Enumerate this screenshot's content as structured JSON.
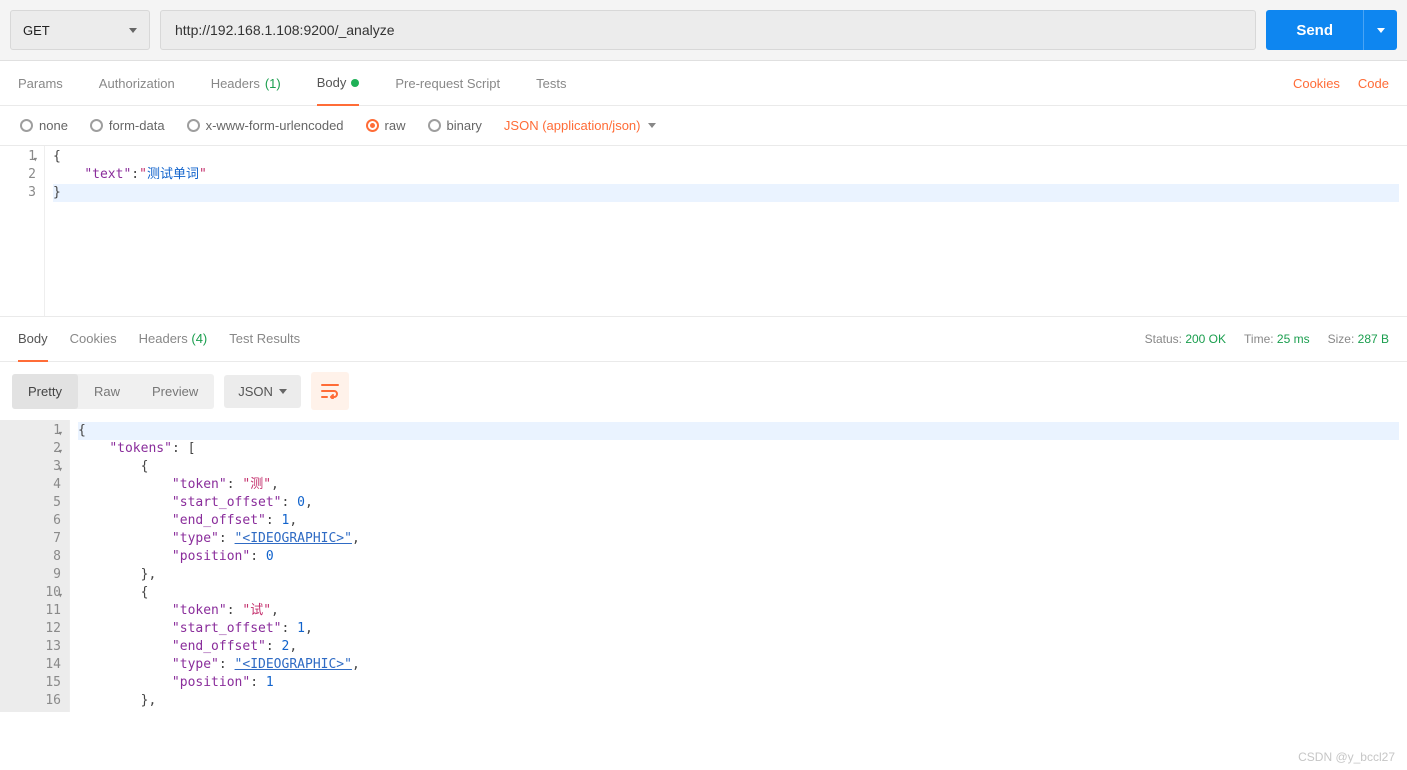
{
  "request": {
    "method": "GET",
    "url": "http://192.168.1.108:9200/_analyze",
    "send_label": "Send"
  },
  "req_tabs": {
    "params": "Params",
    "auth": "Authorization",
    "headers": "Headers",
    "headers_count": "(1)",
    "body": "Body",
    "prereq": "Pre-request Script",
    "tests": "Tests"
  },
  "header_links": {
    "cookies": "Cookies",
    "code": "Code"
  },
  "body_types": {
    "none": "none",
    "formdata": "form-data",
    "xform": "x-www-form-urlencoded",
    "raw": "raw",
    "binary": "binary",
    "content_type": "JSON (application/json)"
  },
  "req_body": {
    "lines": [
      "1",
      "2",
      "3"
    ],
    "l1": "{",
    "l2_key": "\"text\"",
    "l2_colon": ":",
    "l2_val1": "\"",
    "l2_val2": "测试单词",
    "l2_val3": "\"",
    "l3": "}"
  },
  "resp_tabs": {
    "body": "Body",
    "cookies": "Cookies",
    "headers": "Headers",
    "headers_count": "(4)",
    "tests": "Test Results"
  },
  "resp_meta": {
    "status_label": "Status:",
    "status_value": "200 OK",
    "time_label": "Time:",
    "time_value": "25 ms",
    "size_label": "Size:",
    "size_value": "287 B"
  },
  "resp_toolbar": {
    "pretty": "Pretty",
    "raw": "Raw",
    "preview": "Preview",
    "format": "JSON"
  },
  "resp_body": {
    "gutter": [
      "1",
      "2",
      "3",
      "4",
      "5",
      "6",
      "7",
      "8",
      "9",
      "10",
      "11",
      "12",
      "13",
      "14",
      "15",
      "16"
    ],
    "l1": "{",
    "l2_key": "\"tokens\"",
    "l2_rest": ": [",
    "l3": "        {",
    "l4_key": "\"token\"",
    "l4_val": "\"测\"",
    "l5_key": "\"start_offset\"",
    "l5_val": "0",
    "l6_key": "\"end_offset\"",
    "l6_val": "1",
    "l7_key": "\"type\"",
    "l7_val": "\"<IDEOGRAPHIC>\"",
    "l8_key": "\"position\"",
    "l8_val": "0",
    "l9": "        },",
    "l10": "        {",
    "l11_key": "\"token\"",
    "l11_val": "\"试\"",
    "l12_key": "\"start_offset\"",
    "l12_val": "1",
    "l13_key": "\"end_offset\"",
    "l13_val": "2",
    "l14_key": "\"type\"",
    "l14_val": "\"<IDEOGRAPHIC>\"",
    "l15_key": "\"position\"",
    "l15_val": "1",
    "l16": "        },"
  },
  "watermark": "CSDN @y_bccl27"
}
